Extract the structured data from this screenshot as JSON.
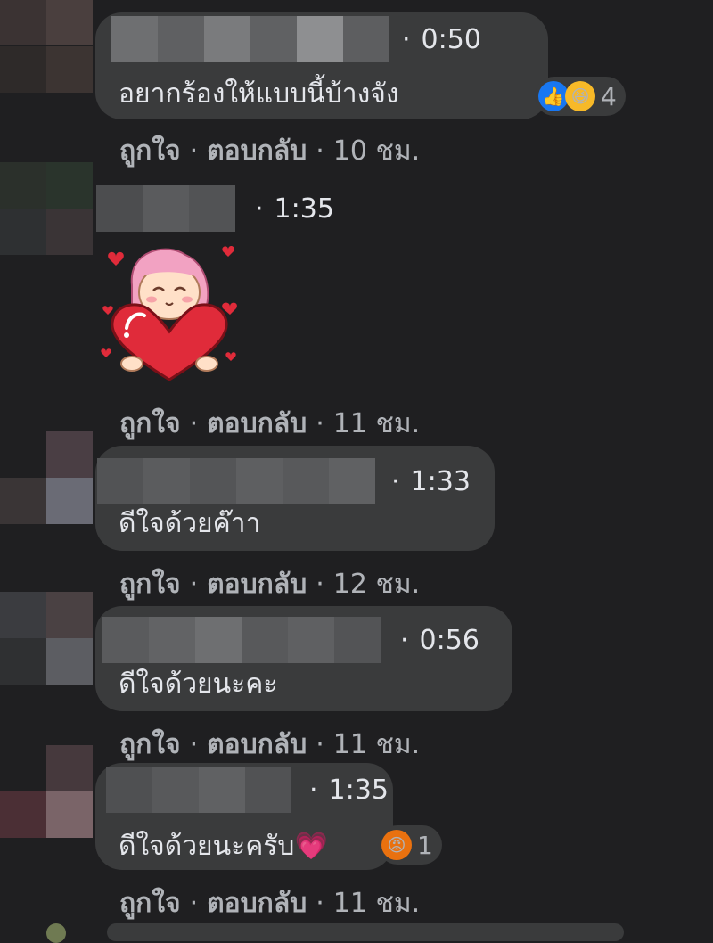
{
  "actions": {
    "like": "ถูกใจ",
    "reply": "ตอบกลับ",
    "sep": "·"
  },
  "comments": [
    {
      "time": "0:50",
      "text": "อยากร้องให้แบบนี้บ้างจัง",
      "age": "10 ชม.",
      "reactions": [
        "like-icon",
        "haha-icon"
      ],
      "reaction_count": "4"
    },
    {
      "time": "1:35",
      "sticker": "girl-hugging-heart-sticker",
      "age": "11 ชม."
    },
    {
      "time": "1:33",
      "text": "ดีใจด้วยค๊าา",
      "age": "12 ชม."
    },
    {
      "time": "0:56",
      "text": "ดีใจด้วยนะคะ",
      "age": "11 ชม."
    },
    {
      "time": "1:35",
      "text": "ดีใจด้วยนะครับ",
      "emoji": "💗",
      "age": "11 ชม.",
      "reactions": [
        "angry-icon"
      ],
      "reaction_count": "1"
    }
  ],
  "colors": {
    "background": "#1f1f21",
    "bubble": "#3a3b3c",
    "text": "#e4e6eb",
    "muted": "#b0b3b8",
    "like_blue": "#1877f2",
    "haha_yellow": "#f7b928",
    "angry_orange": "#e9710f"
  }
}
